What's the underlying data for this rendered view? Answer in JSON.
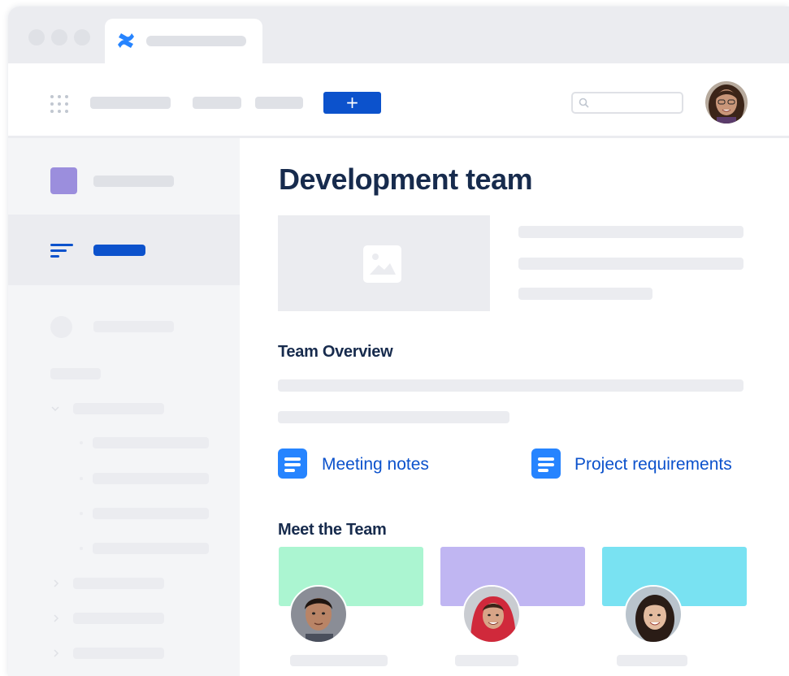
{
  "app": {
    "logo": "confluence-logo-icon"
  },
  "toolbar": {
    "plus_label": "+"
  },
  "page": {
    "title": "Development team",
    "team_overview_heading": "Team Overview",
    "meet_team_heading": "Meet the Team"
  },
  "links": [
    {
      "label": "Meeting notes",
      "icon": "document-icon"
    },
    {
      "label": "Project requirements",
      "icon": "document-icon"
    }
  ],
  "colors": {
    "brand_blue": "#0c52cc",
    "space_icon": "#9b8edd",
    "card_green": "#abf5d1",
    "card_purple": "#c0b6f2",
    "card_teal": "#79e2f2"
  }
}
